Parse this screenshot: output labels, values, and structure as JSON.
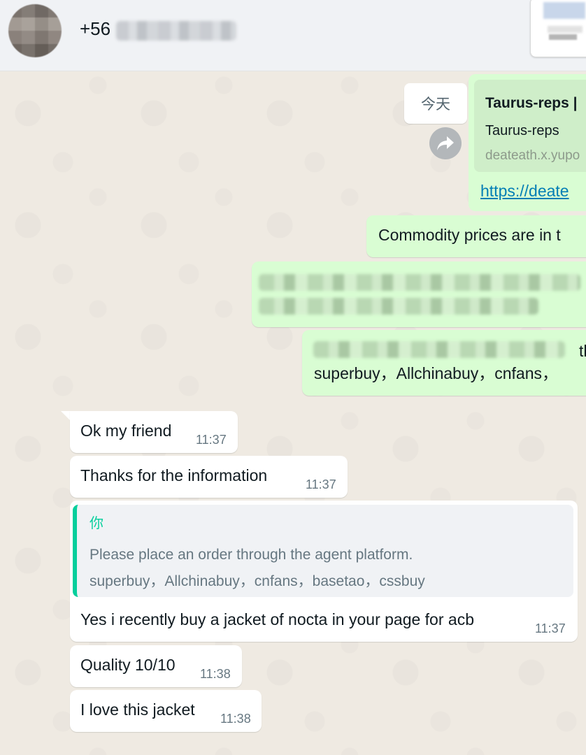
{
  "header": {
    "contact_name": "+56",
    "avatar_icon": "contact-avatar"
  },
  "chat": {
    "date_chip": "今天",
    "forward_icon": "forward-arrow-icon",
    "link_message": {
      "title": "Taurus-reps |",
      "subtitle": "Taurus-reps",
      "domain": "deateath.x.yupo",
      "url": "https://deate"
    },
    "out_messages": [
      {
        "text": "Commodity prices are in t"
      },
      {
        "text": "superbuy，Allchinabuy，cnfans，"
      }
    ],
    "in_messages": [
      {
        "text": "Ok my friend",
        "time": "11:37"
      },
      {
        "text": "Thanks for the information",
        "time": "11:37"
      },
      {
        "quote_author": "你",
        "quote_line1": "Please place an order through the agent platform.",
        "quote_line2": "superbuy，Allchinabuy，cnfans，basetao，cssbuy",
        "text": "Yes i recently buy a jacket of nocta in your page for acb",
        "time": "11:37"
      },
      {
        "text": "Quality 10/10",
        "time": "11:38"
      },
      {
        "text": "I love this jacket",
        "time": "11:38"
      }
    ]
  },
  "colors": {
    "chat_bg": "#efeae2",
    "incoming_bubble": "#ffffff",
    "outgoing_bubble": "#d9fdd3",
    "quote_accent": "#06cf9c",
    "link": "#027eb5",
    "timestamp": "#667781"
  }
}
